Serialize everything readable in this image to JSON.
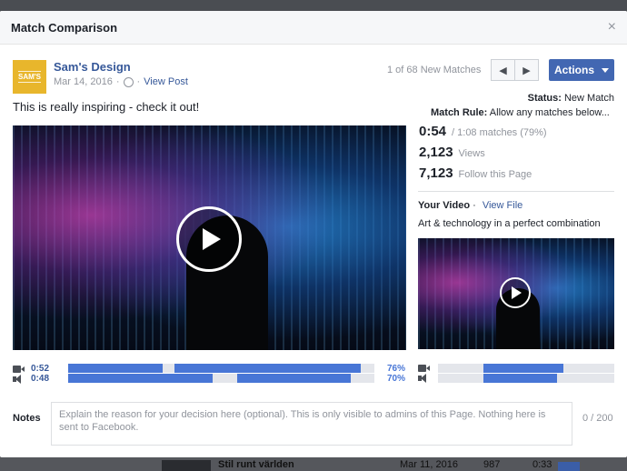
{
  "modal": {
    "title": "Match Comparison",
    "close": "×"
  },
  "post": {
    "avatar_text": "SAM'S",
    "page_name": "Sam's Design",
    "date": "Mar 14, 2016",
    "view_post": "View Post",
    "text": "This is really inspiring - check it out!"
  },
  "nav": {
    "count": "1 of 68 New Matches",
    "prev": "◀",
    "next": "▶",
    "actions": "Actions"
  },
  "details": {
    "status_label": "Status:",
    "status_value": "New Match",
    "rule_label": "Match Rule:",
    "rule_value": "Allow any matches below...",
    "match_time": "0:54",
    "match_detail": "/ 1:08 matches (79%)",
    "views": "2,123",
    "views_label": "Views",
    "follows": "7,123",
    "follows_label": "Follow this Page"
  },
  "your_video": {
    "label": "Your Video",
    "view_file": "View File",
    "description": "Art & technology in a perfect combination"
  },
  "tracks": {
    "video_time": "0:52",
    "audio_time": "0:48",
    "video_pct": "76%",
    "audio_pct": "70%"
  },
  "notes": {
    "label": "Notes",
    "placeholder": "Explain the reason for your decision here (optional). This is only visible to admins of this Page. Nothing here is sent to Facebook.",
    "counter": "0 / 200"
  },
  "background": {
    "title": "Stil runt världen",
    "date": "Mar 11, 2016",
    "views": "987",
    "time": "0:33"
  },
  "colors": {
    "accent": "#4267b2",
    "link": "#365899",
    "match_bar": "#4876d6",
    "avatar": "#e8b62c"
  },
  "icons": [
    "close-icon",
    "globe-icon",
    "play-icon",
    "video-camera-icon",
    "speaker-icon",
    "caret-down-icon"
  ]
}
